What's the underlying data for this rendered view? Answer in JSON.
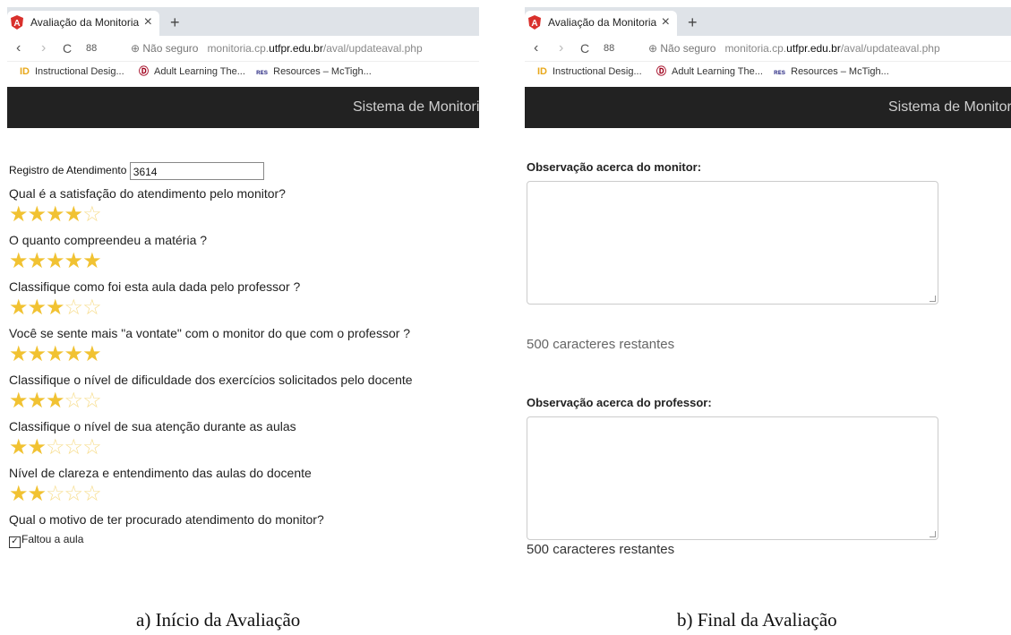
{
  "browser": {
    "tab_title": "Avaliação da Monitoria",
    "close_glyph": "×",
    "new_tab_glyph": "+",
    "secure_label": "Não seguro",
    "url_prefix": "monitoria.cp.",
    "url_domain": "utfpr.edu.br",
    "url_path": "/aval/updateaval.php",
    "back_glyph": "‹",
    "forward_glyph": "›",
    "reload_glyph": "C",
    "apps_glyph": "88",
    "bookmarks": [
      {
        "icon": "ID",
        "label": "Instructional Desig..."
      },
      {
        "icon": "Ⓓ",
        "label": "Adult Learning The..."
      },
      {
        "icon": "ʀᴇs",
        "label": "Resources – McTigh..."
      }
    ]
  },
  "navbar": {
    "title": "Sistema de Monitoria"
  },
  "form_a": {
    "registro_label": "Registro de Atendimento",
    "registro_value": "3614",
    "questions": [
      {
        "text": "Qual é a satisfação do atendimento pelo monitor?",
        "rating": 4
      },
      {
        "text": "O quanto compreendeu a matéria ?",
        "rating": 5
      },
      {
        "text": "Classifique como foi esta aula dada pelo professor ?",
        "rating": 3
      },
      {
        "text": "Você se sente mais \"a vontate\" com o monitor do que com o professor ?",
        "rating": 5
      },
      {
        "text": "Classifique o nível de dificuldade dos exercícios solicitados pelo docente",
        "rating": 3
      },
      {
        "text": "Classifique o nível de sua atenção durante as aulas",
        "rating": 2
      },
      {
        "text": "Nível de clareza e entendimento das aulas do docente",
        "rating": 2
      }
    ],
    "motivo_question": "Qual o motivo de ter procurado atendimento do monitor?",
    "checkbox_label": "Faltou a aula",
    "checkbox_checked": true
  },
  "form_b": {
    "obs_monitor_label": "Observação acerca do monitor:",
    "obs_monitor_counter": "500 caracteres restantes",
    "obs_professor_label": "Observação acerca do professor:",
    "obs_professor_counter": "500 caracteres restantes"
  },
  "captions": {
    "a": "a) Início da Avaliação",
    "b": "b) Final da Avaliação"
  },
  "colors": {
    "star": "#f1c232",
    "navbar": "#222222",
    "tab_logo": "#d9302c"
  }
}
